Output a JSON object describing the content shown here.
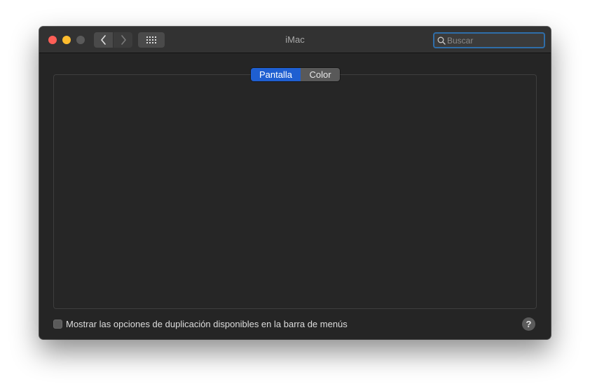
{
  "window": {
    "title": "iMac"
  },
  "search": {
    "value": "",
    "placeholder": "Buscar"
  },
  "toolbar": {
    "back_icon": "chevron-left-icon",
    "forward_icon": "chevron-right-icon",
    "grid_icon": "grid-icon"
  },
  "tabs": [
    {
      "label": "Pantalla",
      "selected": true
    },
    {
      "label": "Color",
      "selected": false
    }
  ],
  "footer": {
    "checkbox_label": "Mostrar las opciones de duplicación disponibles en la barra de menús",
    "checkbox_checked": false,
    "help_label": "?"
  },
  "colors": {
    "window_bg": "#252525",
    "titlebar_bg": "#323232",
    "accent": "#1f5fd1",
    "search_focus_ring": "#2f6ea9",
    "close": "#ff5f57",
    "minimize": "#febc2e",
    "zoom_disabled": "#5a5a5a"
  }
}
